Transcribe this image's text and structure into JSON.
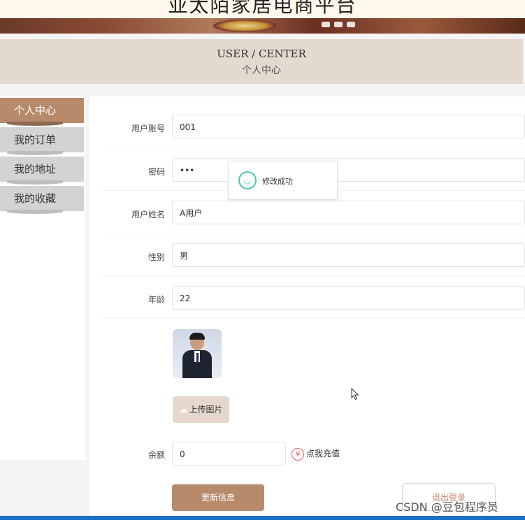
{
  "banner": {
    "title": "亚太陌家居电商平台"
  },
  "center": {
    "title_en": "USER / CENTER",
    "title_cn": "个人中心"
  },
  "sidebar": {
    "items": [
      {
        "label": "个人中心",
        "active": true
      },
      {
        "label": "我的订单",
        "active": false
      },
      {
        "label": "我的地址",
        "active": false
      },
      {
        "label": "我的收藏",
        "active": false
      }
    ]
  },
  "form": {
    "account": {
      "label": "用户账号",
      "value": "001"
    },
    "password": {
      "label": "密码",
      "value": "•••"
    },
    "name": {
      "label": "用户姓名",
      "value": "A用户"
    },
    "gender": {
      "label": "性别",
      "value": "男"
    },
    "age": {
      "label": "年龄",
      "value": "22"
    },
    "upload_label": "上传图片",
    "balance": {
      "label": "余额",
      "value": "0"
    },
    "recharge_label": "点我充值",
    "recharge_icon": "¥"
  },
  "toast": {
    "message": "修改成功",
    "icon": "smile-icon"
  },
  "actions": {
    "update_label": "更新信息",
    "logout_label": "退出登录"
  },
  "watermark": "CSDN @豆包程序员",
  "colors": {
    "accent": "#b88a6c",
    "header_bg": "#e4d9ce",
    "success": "#4dc9a4",
    "taskbar": "#1a6fc9"
  }
}
